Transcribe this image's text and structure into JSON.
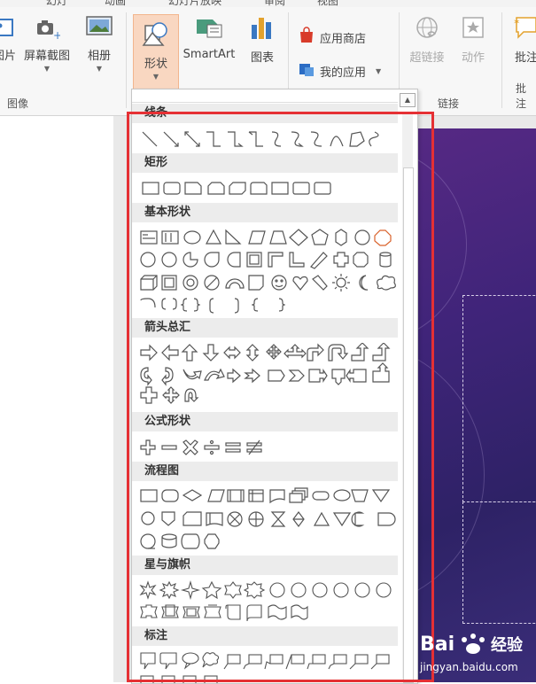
{
  "ribbon": {
    "tabs": [
      "幻灯",
      "动画",
      "幻灯片放映",
      "审阅",
      "视图"
    ],
    "images_group": {
      "label": "图像",
      "buttons": [
        {
          "label": "图片",
          "icon": "picture-icon"
        },
        {
          "label": "屏幕截图",
          "icon": "screenshot-icon"
        },
        {
          "label": "相册",
          "icon": "album-icon"
        }
      ]
    },
    "illustrations": {
      "shapes_label": "形状",
      "smartart_label": "SmartArt",
      "chart_label": "图表"
    },
    "apps": {
      "store_label": "应用商店",
      "my_apps_label": "我的应用"
    },
    "links_group": {
      "label": "链接",
      "hyperlink_label": "超链接",
      "action_label": "动作"
    },
    "comments_group": {
      "label": "批注",
      "comment_label": "批注"
    }
  },
  "gallery": {
    "categories": [
      {
        "title": "线条"
      },
      {
        "title": "矩形"
      },
      {
        "title": "基本形状"
      },
      {
        "title": "箭头总汇"
      },
      {
        "title": "公式形状"
      },
      {
        "title": "流程图"
      },
      {
        "title": "星与旗帜"
      },
      {
        "title": "标注"
      }
    ]
  },
  "watermark": {
    "url": "jingyan.baidu.com"
  },
  "colors": {
    "highlight_frame": "#e53034",
    "active_button": "#f9d7c1",
    "slide_bg": "#3f2479"
  }
}
